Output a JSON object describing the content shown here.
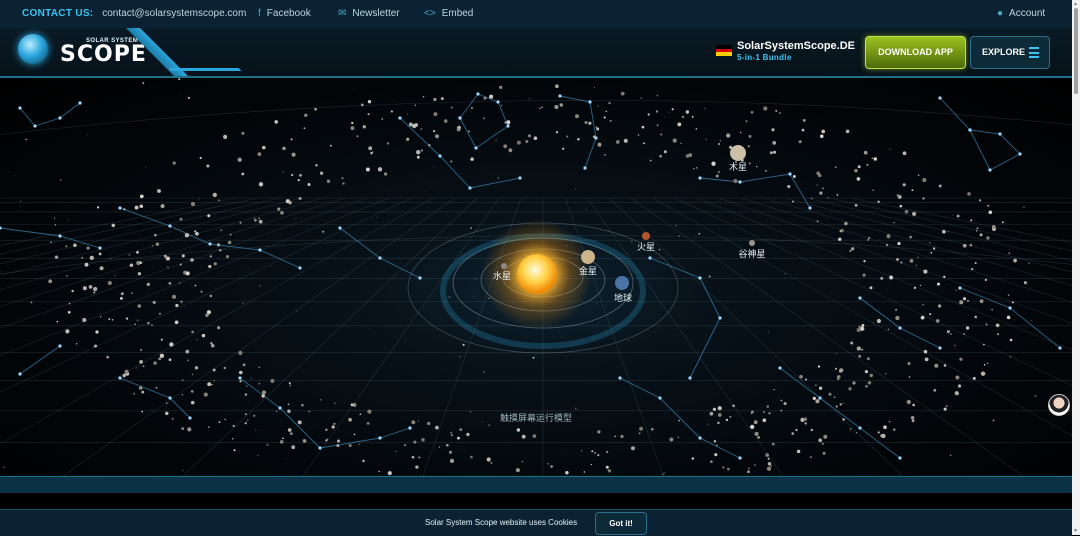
{
  "topbar": {
    "contact_label": "CONTACT US:",
    "contact_email": "contact@solarsystemscope.com",
    "links": [
      {
        "label": "Facebook",
        "icon": "facebook-icon"
      },
      {
        "label": "Newsletter",
        "icon": "mail-icon"
      },
      {
        "label": "Embed",
        "icon": "code-icon"
      }
    ],
    "account_label": "Account"
  },
  "header": {
    "logo_small": "SOLAR SYSTEM",
    "logo_big": "SCOPE",
    "brand_name": "SolarSystemScope.DE",
    "brand_sub": "5-in-1 Bundle",
    "download_label": "DOWNLOAD APP",
    "explore_label": "EXPLORE",
    "accent_color": "#3ec3f3",
    "download_color": "#8bb21a"
  },
  "scene": {
    "planets": [
      {
        "name": "水星",
        "color": "#8d8a86"
      },
      {
        "name": "金星",
        "color": "#c9b48c"
      },
      {
        "name": "地球",
        "color": "#4a73a8"
      },
      {
        "name": "火星",
        "color": "#b3562f"
      },
      {
        "name": "木星",
        "color": "#cdbfa8"
      },
      {
        "name": "谷神星",
        "color": "#9a958c"
      }
    ],
    "hint": "触摸屏幕运行模型"
  },
  "cookie": {
    "text": "Solar System Scope website uses Cookies",
    "button_label": "Got it!"
  }
}
